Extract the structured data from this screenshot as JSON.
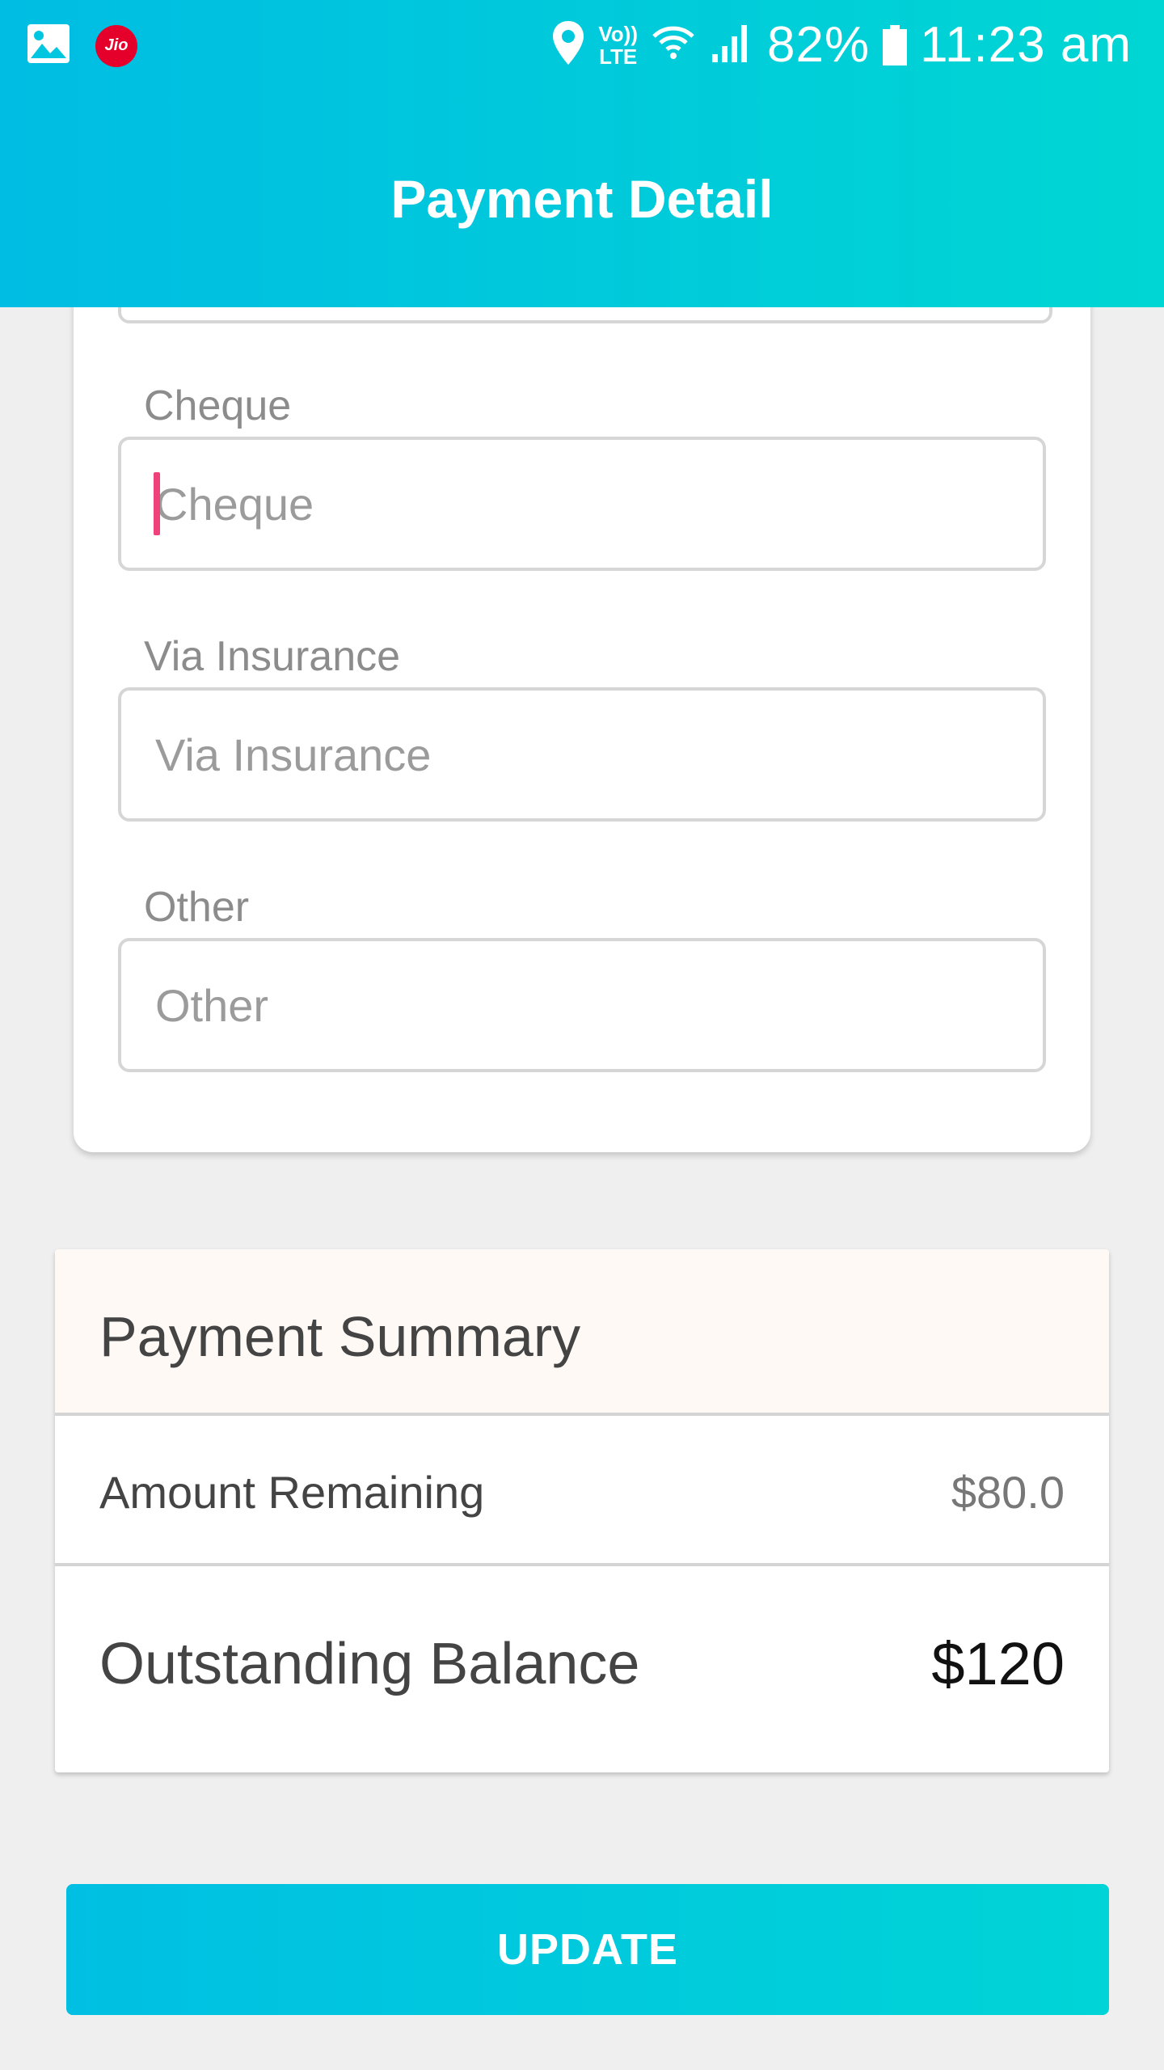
{
  "status_bar": {
    "carrier_badge": "Jio",
    "volte_top": "Vo))",
    "volte_bottom": "LTE",
    "battery_percent": "82%",
    "time": "11:23 am",
    "icons": [
      "gallery-icon",
      "jio-icon",
      "location-icon",
      "volte-icon",
      "wifi-icon",
      "signal-icon",
      "battery-icon"
    ]
  },
  "header": {
    "title": "Payment Detail",
    "colors": {
      "gradient_start": "#00bde3",
      "gradient_end": "#00d6d3"
    }
  },
  "form": {
    "fields": [
      {
        "label": "Cheque",
        "placeholder": "Cheque",
        "value": "",
        "focused": true
      },
      {
        "label": "Via Insurance",
        "placeholder": "Via Insurance",
        "value": ""
      },
      {
        "label": "Other",
        "placeholder": "Other",
        "value": ""
      }
    ]
  },
  "summary": {
    "title": "Payment Summary",
    "amount_remaining_label": "Amount Remaining",
    "amount_remaining_value": "$80.0",
    "outstanding_label": "Outstanding Balance",
    "outstanding_value": "$120"
  },
  "actions": {
    "update_label": "UPDATE",
    "colors": {
      "button": "#00c8dd",
      "cursor": "#f0427a"
    }
  }
}
